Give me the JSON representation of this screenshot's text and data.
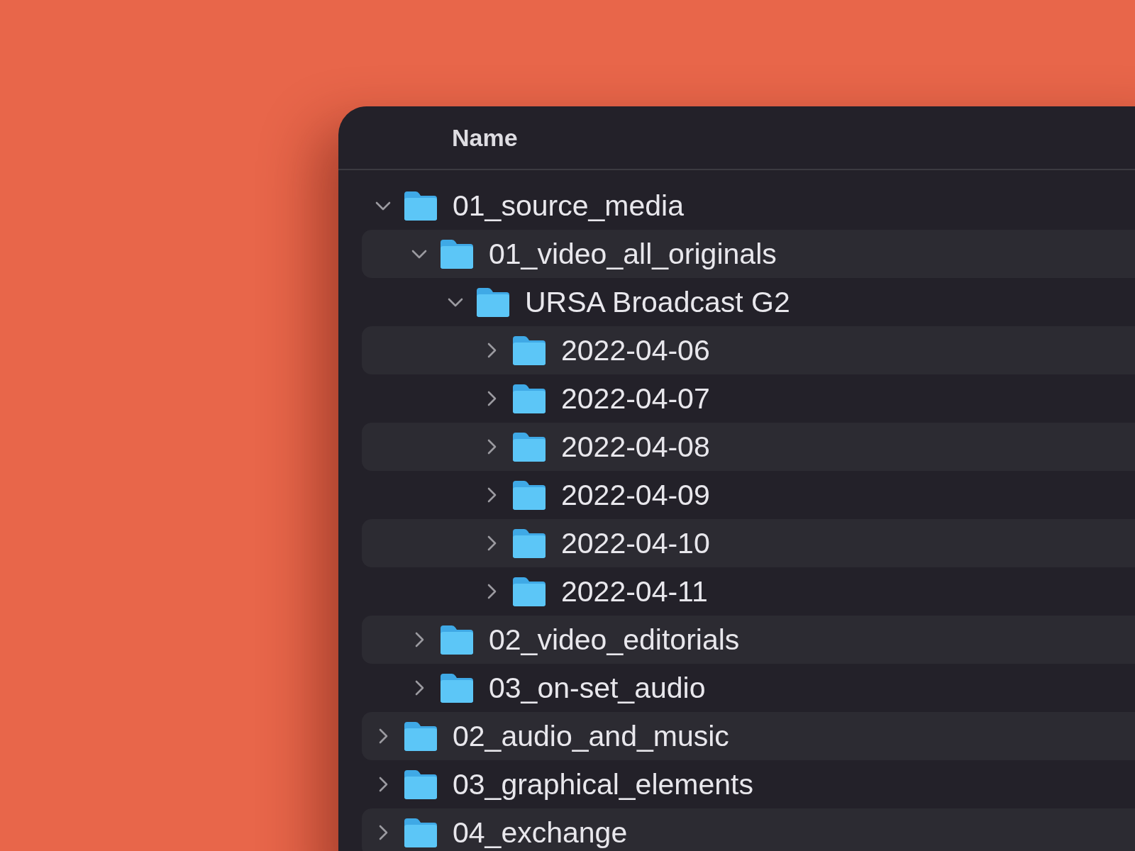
{
  "header": {
    "column": "Name"
  },
  "tree": [
    {
      "name": "01_source_media",
      "expanded": true,
      "children": [
        {
          "name": "01_video_all_originals",
          "expanded": true,
          "children": [
            {
              "name": "URSA Broadcast G2",
              "expanded": true,
              "children": [
                {
                  "name": "2022-04-06",
                  "expanded": false
                },
                {
                  "name": "2022-04-07",
                  "expanded": false
                },
                {
                  "name": "2022-04-08",
                  "expanded": false
                },
                {
                  "name": "2022-04-09",
                  "expanded": false
                },
                {
                  "name": "2022-04-10",
                  "expanded": false
                },
                {
                  "name": "2022-04-11",
                  "expanded": false
                }
              ]
            }
          ]
        },
        {
          "name": "02_video_editorials",
          "expanded": false
        },
        {
          "name": "03_on-set_audio",
          "expanded": false
        }
      ]
    },
    {
      "name": "02_audio_and_music",
      "expanded": false
    },
    {
      "name": "03_graphical_elements",
      "expanded": false
    },
    {
      "name": "04_exchange",
      "expanded": false
    }
  ]
}
